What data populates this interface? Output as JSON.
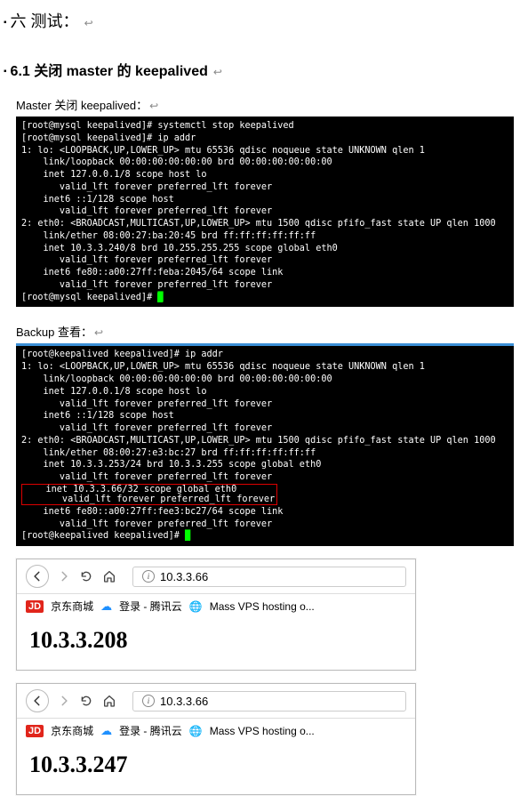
{
  "heading6": {
    "bullet": "▪",
    "label": "六 测试：",
    "ret": "↩"
  },
  "section61": {
    "bullet": "▪",
    "label": "6.1  关闭 master 的 keepalived",
    "ret": "↩"
  },
  "master": {
    "caption": "Master 关闭 keepalived：",
    "ret": "↩",
    "lines": [
      "[root@mysql keepalived]# systemctl stop keepalived",
      "[root@mysql keepalived]# ip addr",
      "1: lo: <LOOPBACK,UP,LOWER_UP> mtu 65536 qdisc noqueue state UNKNOWN qlen 1",
      "    link/loopback 00:00:00:00:00:00 brd 00:00:00:00:00:00",
      "    inet 127.0.0.1/8 scope host lo",
      "       valid_lft forever preferred_lft forever",
      "    inet6 ::1/128 scope host",
      "       valid_lft forever preferred_lft forever",
      "2: eth0: <BROADCAST,MULTICAST,UP,LOWER_UP> mtu 1500 qdisc pfifo_fast state UP qlen 1000",
      "    link/ether 08:00:27:ba:20:45 brd ff:ff:ff:ff:ff:ff",
      "    inet 10.3.3.240/8 brd 10.255.255.255 scope global eth0",
      "       valid_lft forever preferred_lft forever",
      "    inet6 fe80::a00:27ff:feba:2045/64 scope link",
      "       valid_lft forever preferred_lft forever",
      "[root@mysql keepalived]# "
    ]
  },
  "backup": {
    "caption": "Backup 查看：",
    "ret": "↩",
    "lines_pre": [
      "[root@keepalived keepalived]# ip addr",
      "1: lo: <LOOPBACK,UP,LOWER_UP> mtu 65536 qdisc noqueue state UNKNOWN qlen 1",
      "    link/loopback 00:00:00:00:00:00 brd 00:00:00:00:00:00",
      "    inet 127.0.0.1/8 scope host lo",
      "       valid_lft forever preferred_lft forever",
      "    inet6 ::1/128 scope host",
      "       valid_lft forever preferred_lft forever",
      "2: eth0: <BROADCAST,MULTICAST,UP,LOWER_UP> mtu 1500 qdisc pfifo_fast state UP qlen 1000",
      "    link/ether 08:00:27:e3:bc:27 brd ff:ff:ff:ff:ff:ff",
      "    inet 10.3.3.253/24 brd 10.3.3.255 scope global eth0",
      "       valid_lft forever preferred_lft forever"
    ],
    "highlight": [
      "    inet 10.3.3.66/32 scope global eth0",
      "       valid_lft forever preferred_lft forever"
    ],
    "lines_post": [
      "    inet6 fe80::a00:27ff:fee3:bc27/64 scope link",
      "       valid_lft forever preferred_lft forever",
      "[root@keepalived keepalived]# "
    ]
  },
  "browser1": {
    "url": "10.3.3.66",
    "bookmarks": {
      "jd": "JD",
      "jd_text": "京东商城",
      "qcloud": "登录 - 腾讯云",
      "mass": "Mass VPS hosting o..."
    },
    "page_ip": "10.3.3.208"
  },
  "browser2": {
    "url": "10.3.3.66",
    "bookmarks": {
      "jd": "JD",
      "jd_text": "京东商城",
      "qcloud": "登录 - 腾讯云",
      "mass": "Mass VPS hosting o..."
    },
    "page_ip": "10.3.3.247"
  }
}
